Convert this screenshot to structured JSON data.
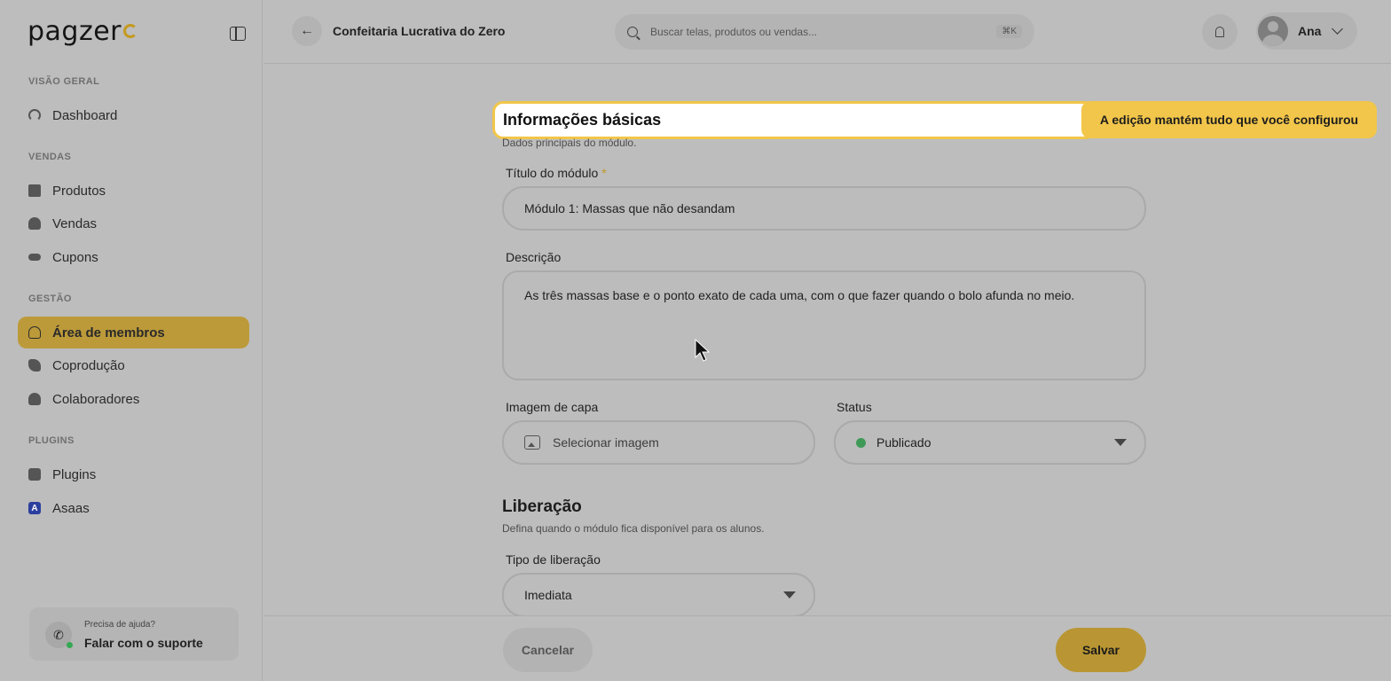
{
  "brand": {
    "logo_text": "pagzer",
    "accent": "#c49a1f"
  },
  "sidebar": {
    "sections": [
      {
        "label": "VISÃO GERAL"
      },
      {
        "label": "VENDAS"
      },
      {
        "label": "GESTÃO"
      },
      {
        "label": "PLUGINS"
      }
    ],
    "items": [
      {
        "label": "Dashboard",
        "icon": "dashboard-icon"
      },
      {
        "label": "Produtos",
        "icon": "products-icon"
      },
      {
        "label": "Vendas",
        "icon": "sales-icon"
      },
      {
        "label": "Cupons",
        "icon": "coupon-icon"
      },
      {
        "label": "Área de membros",
        "icon": "members-icon",
        "active": true
      },
      {
        "label": "Coprodução",
        "icon": "handshake-icon"
      },
      {
        "label": "Colaboradores",
        "icon": "collaborators-icon"
      },
      {
        "label": "Plugins",
        "icon": "puzzle-icon"
      },
      {
        "label": "Asaas",
        "icon": "asaas-icon"
      }
    ],
    "help": {
      "small": "Precisa de ajuda?",
      "big": "Falar com o suporte"
    }
  },
  "header": {
    "title": "Confeitaria Lucrativa do Zero",
    "search_placeholder": "Buscar telas, produtos ou vendas...",
    "search_shortcut": "⌘K",
    "user_name": "Ana"
  },
  "form": {
    "section_basic": "Informações básicas",
    "tooltip": "A edição mantém tudo que você configurou",
    "section_basic_sub": "Dados principais do módulo.",
    "title_label": "Título do módulo",
    "title_required": "*",
    "title_value": "Módulo 1: Massas que não desandam",
    "description_label": "Descrição",
    "description_value": "As três massas base e o ponto exato de cada uma, com o que fazer quando o bolo afunda no meio.",
    "cover_label": "Imagem de capa",
    "cover_button": "Selecionar imagem",
    "status_label": "Status",
    "status_value": "Publicado",
    "status_color": "#3f9a57",
    "release_title": "Liberação",
    "release_sub": "Defina quando o módulo fica disponível para os alunos.",
    "release_type_label": "Tipo de liberação",
    "release_type_value": "Imediata"
  },
  "footer": {
    "cancel_label": "Cancelar",
    "save_label": "Salvar"
  }
}
